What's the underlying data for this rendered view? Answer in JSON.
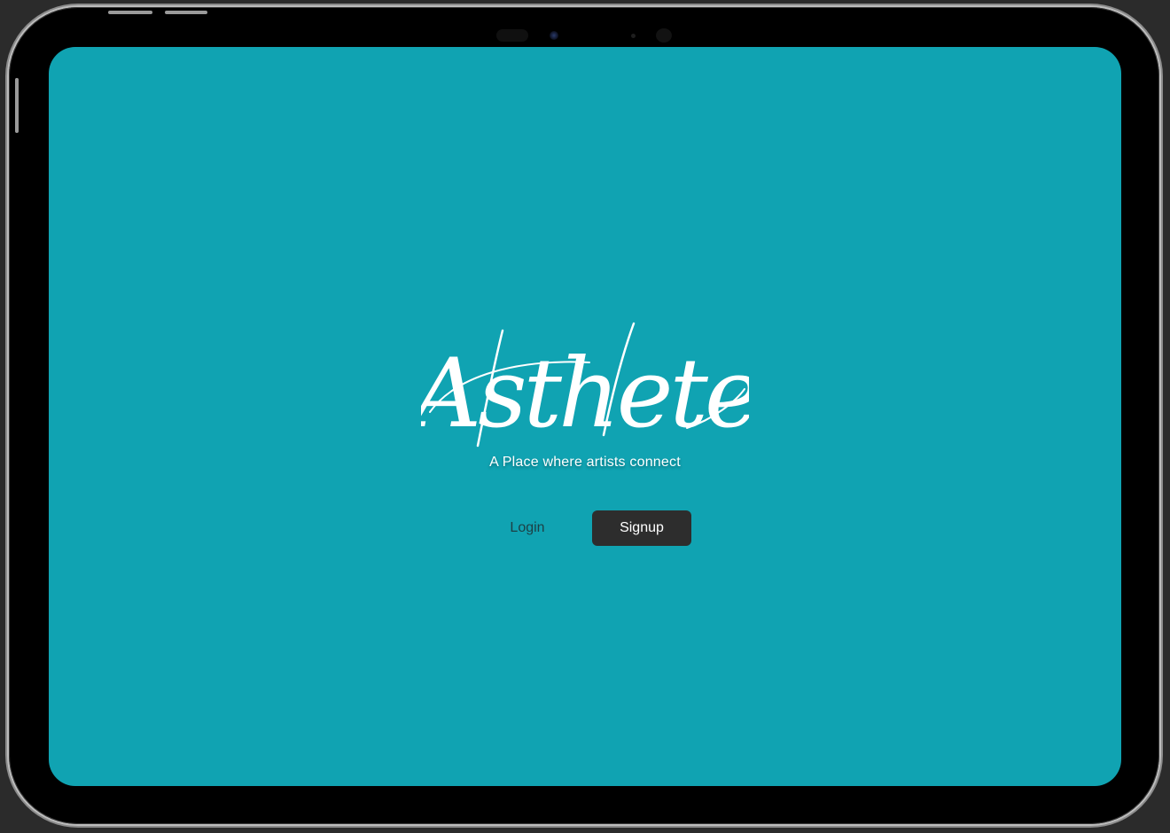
{
  "app": {
    "logo_text": "Asthete",
    "tagline": "A Place where artists connect"
  },
  "actions": {
    "login_label": "Login",
    "signup_label": "Signup"
  },
  "colors": {
    "screen_background": "#10a3b2",
    "signup_button": "#2d2d2d",
    "text_light": "#ffffff"
  }
}
